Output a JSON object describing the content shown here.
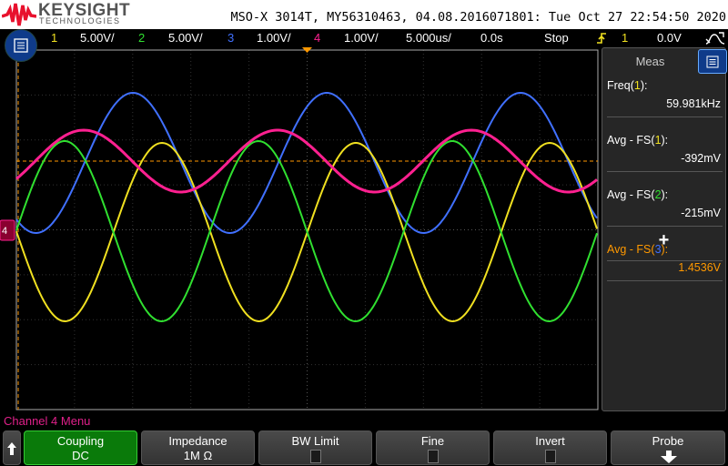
{
  "header": {
    "brand": "KEYSIGHT",
    "brand_sub": "TECHNOLOGIES",
    "title": "MSO-X 3014T, MY56310463, 04.08.2016071801: Tue Oct 27 22:54:50 2020"
  },
  "status": {
    "channels": [
      {
        "num": "1",
        "scale": "5.00V/",
        "color": "#f0e020"
      },
      {
        "num": "2",
        "scale": "5.00V/",
        "color": "#30e030"
      },
      {
        "num": "3",
        "scale": "1.00V/",
        "color": "#4070ff"
      },
      {
        "num": "4",
        "scale": "1.00V/",
        "color": "#ff2090"
      }
    ],
    "timebase": "5.000us/",
    "delay": "0.0s",
    "run_state": "Stop",
    "trigger_source": "1",
    "trigger_level": "0.0V",
    "trigger_icon": "rising-edge-icon"
  },
  "meas": {
    "tab": "Meas",
    "items": [
      {
        "label_pre": "Freq(",
        "ch": "1",
        "label_post": "):",
        "value": "59.981kHz",
        "ch_color": "#f0e020",
        "color": "#ffffff"
      },
      {
        "label_pre": "Avg - FS(",
        "ch": "1",
        "label_post": "):",
        "value": "-392mV",
        "ch_color": "#f0e020",
        "color": "#ffffff"
      },
      {
        "label_pre": "Avg - FS(",
        "ch": "2",
        "label_post": "):",
        "value": "-215mV",
        "ch_color": "#30e030",
        "color": "#ffffff"
      },
      {
        "label_pre": "Avg - FS(",
        "ch": "3",
        "label_post": "):",
        "value": "1.4536V",
        "ch_color": "#4070ff",
        "color": "#ff9900"
      }
    ],
    "add": "+"
  },
  "menu": {
    "title": "Channel 4 Menu",
    "softkeys": [
      {
        "l1": "Coupling",
        "l2": "DC"
      },
      {
        "l1": "Impedance",
        "l2": "1M Ω"
      },
      {
        "l1": "BW Limit",
        "checked": false
      },
      {
        "l1": "Fine",
        "checked": false
      },
      {
        "l1": "Invert",
        "checked": false
      },
      {
        "l1": "Probe"
      }
    ]
  },
  "ground_marker": "4"
}
